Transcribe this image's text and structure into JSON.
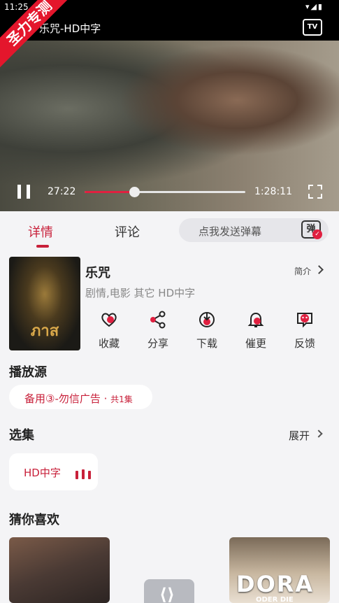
{
  "status_bar": {
    "time": "11:25",
    "icons": "▾◢▮"
  },
  "watermark": "圣力专测",
  "player": {
    "title": "乐咒-HD中字",
    "tv_label": "TV",
    "current_time": "27:22",
    "total_time": "1:28:11",
    "progress_fraction": 0.31
  },
  "tabs": [
    {
      "label": "详情",
      "active": true
    },
    {
      "label": "评论",
      "active": false
    }
  ],
  "danmaku": {
    "placeholder": "点我发送弹幕",
    "icon_text": "弹",
    "icon": "danmaku-toggle-icon"
  },
  "movie": {
    "title": "乐咒",
    "intro_label": "简介",
    "meta": "剧情,电影 其它 HD中字",
    "poster_text": "ภาส"
  },
  "actions": [
    {
      "label": "收藏",
      "icon": "heart-icon"
    },
    {
      "label": "分享",
      "icon": "share-icon"
    },
    {
      "label": "下载",
      "icon": "download-icon"
    },
    {
      "label": "催更",
      "icon": "bell-icon"
    },
    {
      "label": "反馈",
      "icon": "feedback-icon"
    }
  ],
  "sources": {
    "title": "播放源",
    "selected_label": "备用③-勿信广告 · ",
    "selected_count": "共1集"
  },
  "episodes": {
    "title": "选集",
    "expand_label": "展开",
    "items": [
      {
        "label": "HD中字",
        "playing": true
      }
    ]
  },
  "recommend": {
    "title": "猜你喜欢",
    "items": [
      {
        "poster": "image"
      },
      {
        "poster": "placeholder"
      },
      {
        "poster": "image",
        "title_text": "DORA",
        "subtitle_text": "ODER DIE"
      }
    ]
  },
  "colors": {
    "accent": "#c8203a",
    "watermark": "#e4162c",
    "background": "#f4f4f6"
  }
}
